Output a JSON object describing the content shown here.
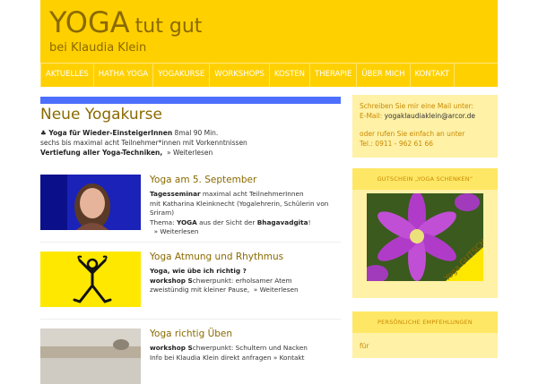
{
  "header": {
    "title_main": "YOGA",
    "title_rest": "tut gut",
    "subtitle": "bei Klaudia Klein"
  },
  "nav": {
    "items": [
      {
        "label": "AKTUELLES"
      },
      {
        "label": "HATHA YOGA"
      },
      {
        "label": "YOGAKURSE"
      },
      {
        "label": "WORKSHOPS"
      },
      {
        "label": "KOSTEN"
      },
      {
        "label": "THERAPIE"
      },
      {
        "label": "ÜBER MICH"
      },
      {
        "label": "KONTAKT"
      }
    ]
  },
  "main": {
    "heading": "Neue Yogakurse",
    "intro": {
      "line1_bold": "♣ Yoga für Wieder-EinsteigerInnen",
      "line1_rest": " 8mal 90 Min.",
      "line2": "sechs bis maximal acht Teilnehmer*innen mit Vorkenntnissen",
      "line3_bold": "Vertiefung aller Yoga-Techniken,",
      "line3_link": "» Weiterlesen"
    },
    "posts": [
      {
        "title": "Yoga am 5. September",
        "l1_bold": "Tagesseminar",
        "l1_rest": " maximal acht TeilnehmerInnen",
        "l2": "mit Katharina Kleinknecht (Yogalehrerin, Schülerin von Sriram)",
        "l3_a": "Thema: ",
        "l3_b": "YOGA",
        "l3_c": " aus der Sicht der ",
        "l3_d": "Bhagavadgita",
        "l3_e": "!",
        "link": "» Weiterlesen"
      },
      {
        "title": "Yoga Atmung und Rhythmus",
        "l1_bold": "Yoga,  wie übe ich richtig ?",
        "l2_bold": "workshop S",
        "l2_rest": "chwerpunkt: erholsamer Atem",
        "l3": "zweistündig mit kleiner Pause,",
        "link": "» Weiterlesen"
      },
      {
        "title": "Yoga richtig Üben",
        "l1_bold": "workshop S",
        "l1_rest": "chwerpunkt: Schultern und Nacken",
        "l2": "Info bei Klaudia Klein direkt anfragen » Kontakt"
      }
    ]
  },
  "sidebar": {
    "contact": {
      "l1": "Schreiben Sie mir eine Mail unter:",
      "l2_label": "E-Mail: ",
      "l2_email": "yogaklaudiaklein@arcor.de",
      "l3": "oder rufen Sie einfach an unter",
      "l4": "Tel.: 0911 - 962 61 66"
    },
    "voucher_heading": "GUTSCHEIN „YOGA SCHENKEN“",
    "voucher_text": "Yoga GUTSCHEIN",
    "recommend_heading": "PERSÖNLICHE EMPFEHLUNGEN",
    "recommend_text": "für"
  },
  "colors": {
    "brand_yellow": "#ffd000",
    "title_brown": "#8a6a00",
    "accent_blue": "#4d6fff",
    "sidebar_bg": "#fff1a6"
  }
}
